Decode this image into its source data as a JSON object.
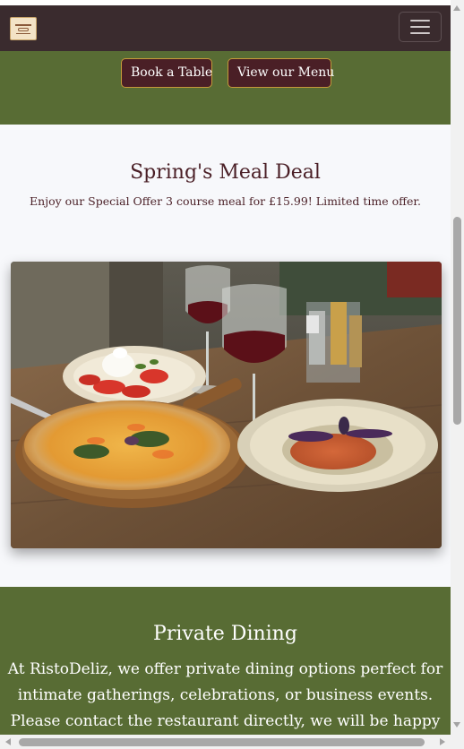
{
  "navbar": {
    "logo": "ristodeliz-logo",
    "menu_icon": "hamburger-menu-icon"
  },
  "hero": {
    "book_label": "Book a Table",
    "menu_label": "View our Menu"
  },
  "offer": {
    "title": "Spring's Meal Deal",
    "subtitle": "Enjoy our Special Offer 3 course meal for £15.99! Limited time offer.",
    "image": "italian-meal-photo"
  },
  "dining": {
    "title": "Private Dining",
    "text": "At RistoDeliz, we offer private dining options perfect for intimate gatherings, celebrations, or business events. Please contact the restaurant directly, we will be happy"
  },
  "colors": {
    "navbar": "#3a2b2e",
    "green": "#586c34",
    "burgundy": "#4a1f26",
    "gold_border": "#c69a3a"
  }
}
